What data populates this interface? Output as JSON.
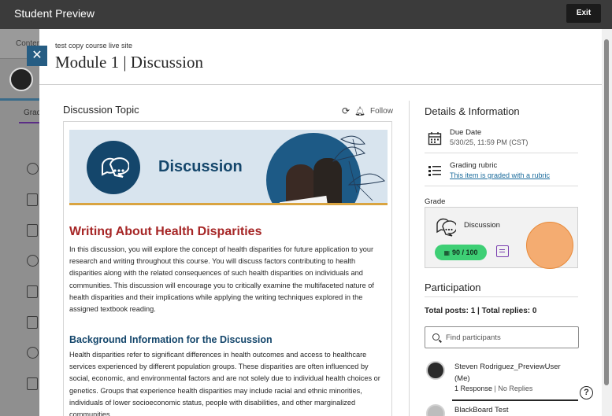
{
  "topbar": {
    "title": "Student Preview",
    "exit_label": "Exit"
  },
  "background": {
    "tab_label": "Conter",
    "grade_tab": "Grad"
  },
  "panel": {
    "breadcrumb": "test copy course live site",
    "title": "Module 1 | Discussion",
    "close_icon": "close-icon"
  },
  "discussion": {
    "heading": "Discussion Topic",
    "follow_label": "Follow",
    "banner_text": "Discussion",
    "h1": "Writing About Health Disparities",
    "p1": "In this discussion, you will explore the concept of health disparities for future application to your research and writing throughout this course. You will discuss factors contributing to health disparities along with the related consequences of such health disparities on individuals and communities. This discussion will encourage you to critically examine the multifaceted nature of health disparities and their implications while applying the writing techniques explored in the assigned textbook reading.",
    "h2": "Background Information for the Discussion",
    "p2": "Health disparities refer to significant differences in health outcomes and access to healthcare services experienced by different population groups. These disparities are often influenced by social, economic, and environmental factors and are not solely due to individual health choices or genetics. Groups that experience health disparities may include racial and ethnic minorities, individuals of lower socioeconomic status, people with disabilities, and other marginalized communities."
  },
  "details": {
    "heading": "Details & Information",
    "due_label": "Due Date",
    "due_value": "5/30/25, 11:59 PM (CST)",
    "rubric_label": "Grading rubric",
    "rubric_link": "This item is graded with a rubric"
  },
  "grade": {
    "label": "Grade",
    "item_name": "Discussion",
    "score": "90 / 100"
  },
  "participation": {
    "heading": "Participation",
    "stats": "Total posts: 1 | Total replies: 0",
    "search_placeholder": "Find participants",
    "users": [
      {
        "name": "Steven Rodriguez_PreviewUser (Me)",
        "responses": "1 Response",
        "replies": "No Replies"
      },
      {
        "name": "BlackBoard Test"
      }
    ]
  },
  "colors": {
    "accent": "#265d83",
    "pill": "#3ecf75",
    "heading_red": "#a62626",
    "heading_blue": "#14466b"
  }
}
